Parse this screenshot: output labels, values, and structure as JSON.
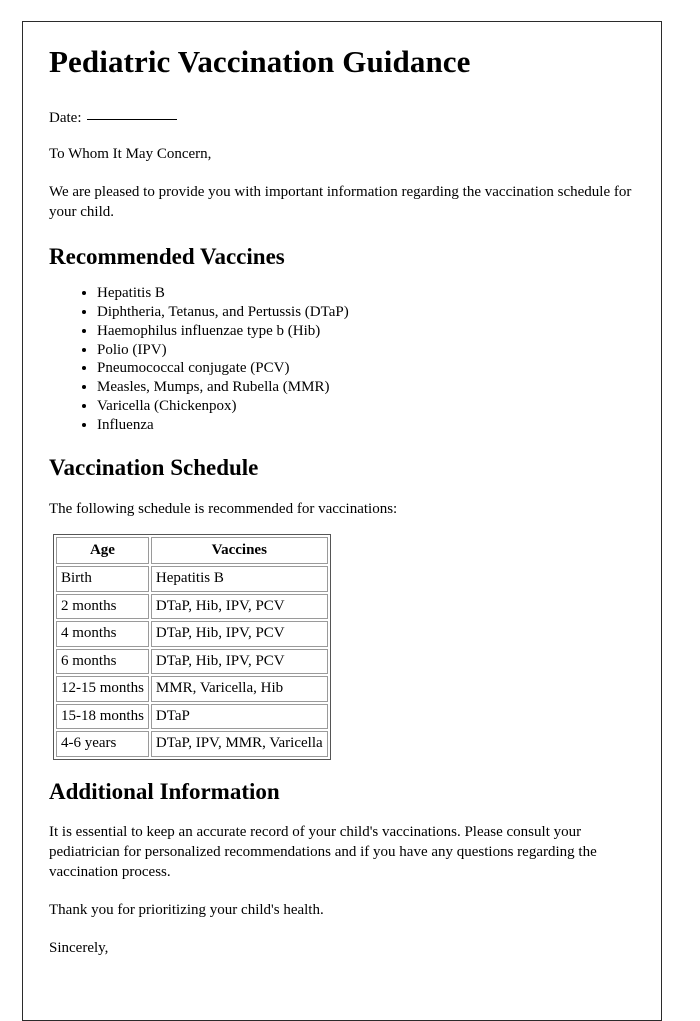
{
  "document": {
    "title": "Pediatric Vaccination Guidance",
    "date_label": "Date:",
    "date_value": "",
    "salutation": "To Whom It May Concern,",
    "intro_paragraph": "We are pleased to provide you with important information regarding the vaccination schedule for your child.",
    "sections": {
      "recommended": {
        "heading": "Recommended Vaccines",
        "items": [
          "Hepatitis B",
          "Diphtheria, Tetanus, and Pertussis (DTaP)",
          "Haemophilus influenzae type b (Hib)",
          "Polio (IPV)",
          "Pneumococcal conjugate (PCV)",
          "Measles, Mumps, and Rubella (MMR)",
          "Varicella (Chickenpox)",
          "Influenza"
        ]
      },
      "schedule": {
        "heading": "Vaccination Schedule",
        "intro": "The following schedule is recommended for vaccinations:",
        "columns": [
          "Age",
          "Vaccines"
        ],
        "rows": [
          [
            "Birth",
            "Hepatitis B"
          ],
          [
            "2 months",
            "DTaP, Hib, IPV, PCV"
          ],
          [
            "4 months",
            "DTaP, Hib, IPV, PCV"
          ],
          [
            "6 months",
            "DTaP, Hib, IPV, PCV"
          ],
          [
            "12-15 months",
            "MMR, Varicella, Hib"
          ],
          [
            "15-18 months",
            "DTaP"
          ],
          [
            "4-6 years",
            "DTaP, IPV, MMR, Varicella"
          ]
        ]
      },
      "additional": {
        "heading": "Additional Information",
        "paragraph": "It is essential to keep an accurate record of your child's vaccinations. Please consult your pediatrician for personalized recommendations and if you have any questions regarding the vaccination process.",
        "thanks": "Thank you for prioritizing your child's health.",
        "signoff": "Sincerely,"
      }
    }
  }
}
